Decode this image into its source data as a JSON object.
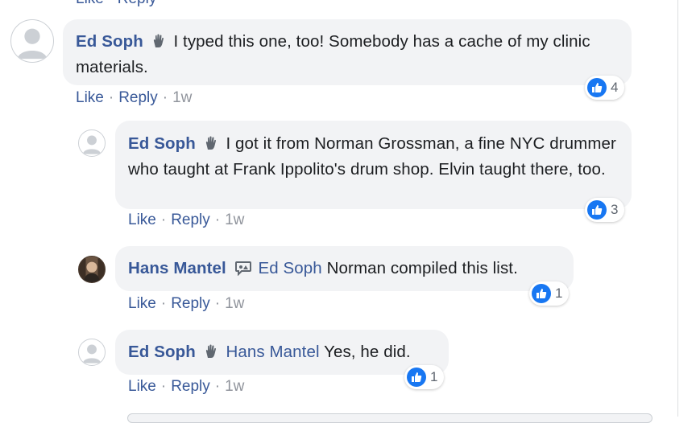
{
  "top_partial": "Like · Reply",
  "comments": [
    {
      "author": "Ed Soph",
      "mention": "",
      "text": "I typed this one, too! Somebody has a cache of my clinic materials.",
      "like_label": "Like",
      "reply_label": "Reply",
      "time": "1w",
      "reaction_count": "4"
    },
    {
      "author": "Ed Soph",
      "mention": "",
      "text": "I got it from Norman Grossman, a fine NYC drummer who taught at Frank Ippolito's drum shop. Elvin taught there, too.",
      "like_label": "Like",
      "reply_label": "Reply",
      "time": "1w",
      "reaction_count": "3"
    },
    {
      "author": "Hans Mantel",
      "mention": "Ed Soph",
      "text": "Norman compiled this list.",
      "like_label": "Like",
      "reply_label": "Reply",
      "time": "1w",
      "reaction_count": "1"
    },
    {
      "author": "Ed Soph",
      "mention": "Hans Mantel",
      "text": "Yes, he did.",
      "like_label": "Like",
      "reply_label": "Reply",
      "time": "1w",
      "reaction_count": "1"
    }
  ],
  "separator": "·",
  "colors": {
    "link": "#385898",
    "bubble": "#f2f3f5",
    "like_blue": "#1877f2",
    "meta_gray": "#90949c"
  },
  "icons": {
    "badge": "wave-hand-icon",
    "badge_alt": "chat-bubble-icon",
    "reaction": "thumbs-up-icon"
  }
}
